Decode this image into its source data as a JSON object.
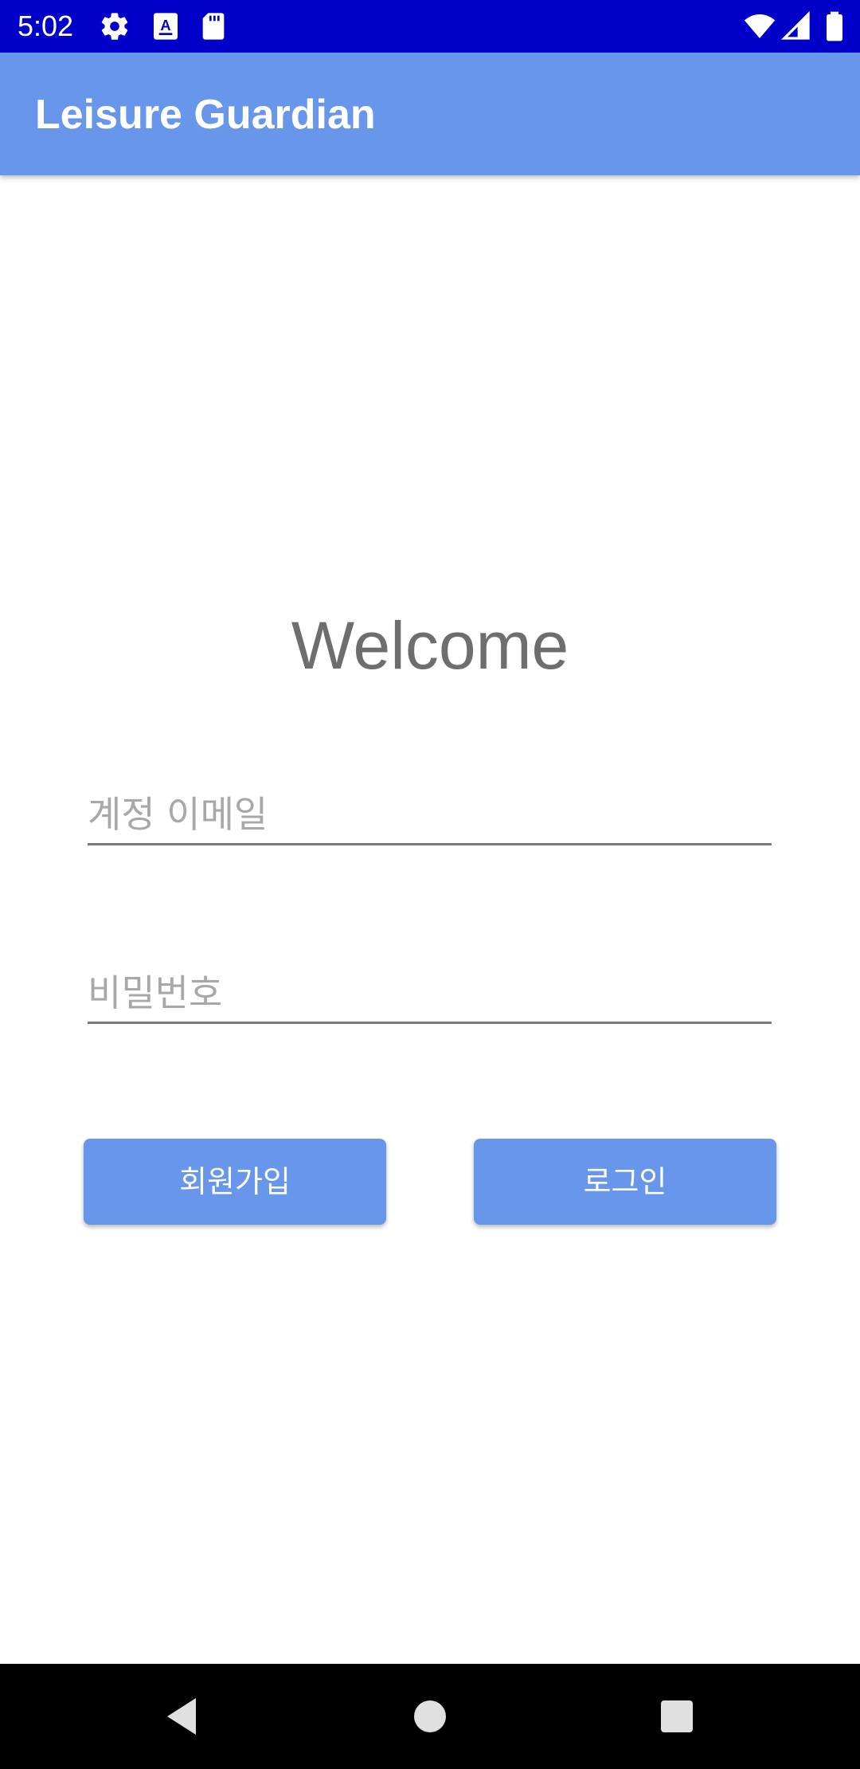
{
  "status_bar": {
    "time": "5:02",
    "icons": [
      "gear-icon",
      "a-icon",
      "sd-card-icon",
      "wifi-icon",
      "signal-icon",
      "battery-icon"
    ],
    "background": "#0000c8"
  },
  "app_bar": {
    "title": "Leisure Guardian",
    "background": "#6796eb"
  },
  "main": {
    "welcome_text": "Welcome",
    "email_placeholder": "계정 이메일",
    "email_value": "",
    "password_placeholder": "비밀번호",
    "password_value": "",
    "signup_label": "회원가입",
    "login_label": "로그인",
    "accent": "#6796eb"
  },
  "nav_bar": {
    "icons": [
      "back-icon",
      "home-icon",
      "recents-icon"
    ]
  }
}
